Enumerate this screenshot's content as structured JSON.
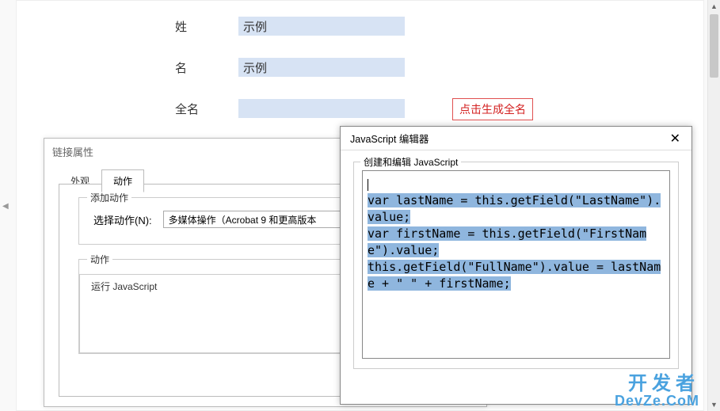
{
  "form": {
    "last_name_label": "姓",
    "last_name_value": "示例",
    "first_name_label": "名",
    "first_name_value": "示例",
    "full_name_label": "全名",
    "full_name_value": "",
    "generate_button": "点击生成全名"
  },
  "link_dialog": {
    "title": "链接属性",
    "tabs": {
      "appearance": "外观",
      "actions": "动作"
    },
    "add_action_legend": "添加动作",
    "select_action_label": "选择动作(N):",
    "select_action_value": "多媒体操作（Acrobat 9 和更高版本",
    "action_legend": "动作",
    "action_item": "运行 JavaScript"
  },
  "js_dialog": {
    "title": "JavaScript 编辑器",
    "legend": "创建和编辑 JavaScript",
    "code": "var lastName = this.getField(\"LastName\").value;\nvar firstName = this.getField(\"FirstName\").value;\nthis.getField(\"FullName\").value = lastName + \" \" + firstName;"
  },
  "watermark": {
    "line1": "开发者",
    "line2": "DevZe.CoM"
  }
}
